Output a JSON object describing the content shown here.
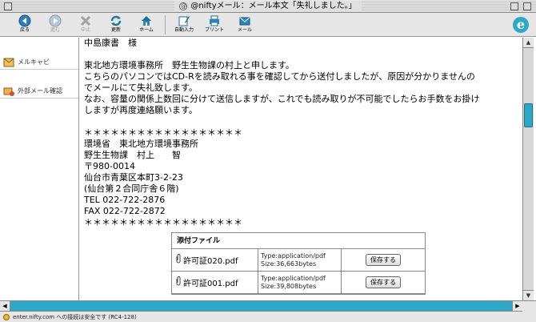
{
  "window": {
    "title": "@niftyメール：メール本文「失礼しました。」"
  },
  "toolbar": {
    "buttons": [
      {
        "label": "戻る",
        "icon": "back-arrow-icon",
        "enabled": true
      },
      {
        "label": "進む",
        "icon": "forward-arrow-icon",
        "enabled": false
      },
      {
        "label": "中止",
        "icon": "stop-icon",
        "enabled": false
      },
      {
        "label": "更新",
        "icon": "refresh-icon",
        "enabled": true
      },
      {
        "label": "ホーム",
        "icon": "home-icon",
        "enabled": true
      },
      {
        "label": "自動入力",
        "icon": "autofill-icon",
        "enabled": true
      },
      {
        "label": "プリント",
        "icon": "print-icon",
        "enabled": true
      },
      {
        "label": "メール",
        "icon": "mail-icon",
        "enabled": true
      }
    ]
  },
  "sidebar": {
    "items": [
      {
        "label": "メルキャビ",
        "icon": "mail-cabinet-icon"
      },
      {
        "label": "外部メール確認",
        "icon": "external-mail-icon"
      }
    ]
  },
  "message": {
    "lines": [
      "中島康書　様",
      "",
      "東北地方環境事務所　野生生物課の村上と申します。",
      "こちらのパソコンではCD-Rを読み取れる事を確認してから送付しましたが、原因が分かりませんの",
      "でメールにて失礼致します。",
      "なお、容量の関係上数回に分けて送信しますが、これでも読み取りが不可能でしたらお手数をお掛け",
      "しますが再度連絡願います。",
      "",
      "＊＊＊＊＊＊＊＊＊＊＊＊＊＊＊＊＊＊",
      "環境省　東北地方環境事務所",
      "野生生物課　村上　　智",
      "〒980-0014",
      "仙台市青葉区本町3-2-23",
      "(仙台第２合同庁舎６階)",
      "TEL 022-722-2876",
      "FAX 022-722-2872",
      "＊＊＊＊＊＊＊＊＊＊＊＊＊＊＊＊＊＊"
    ]
  },
  "attachments": {
    "header": "添付ファイル",
    "files": [
      {
        "name": "許可証020.pdf",
        "type": "Type:application/pdf",
        "size": "Size:36,663bytes",
        "save_label": "保存する"
      },
      {
        "name": "許可証001.pdf",
        "type": "Type:application/pdf",
        "size": "Size:39,808bytes",
        "save_label": "保存する"
      }
    ]
  },
  "status": {
    "text": "enter.nifty.com への接続は安全です (RC4-128)"
  },
  "colors": {
    "accent": "#2fa8c8",
    "toolbar_bg": "#e6e6e6"
  }
}
